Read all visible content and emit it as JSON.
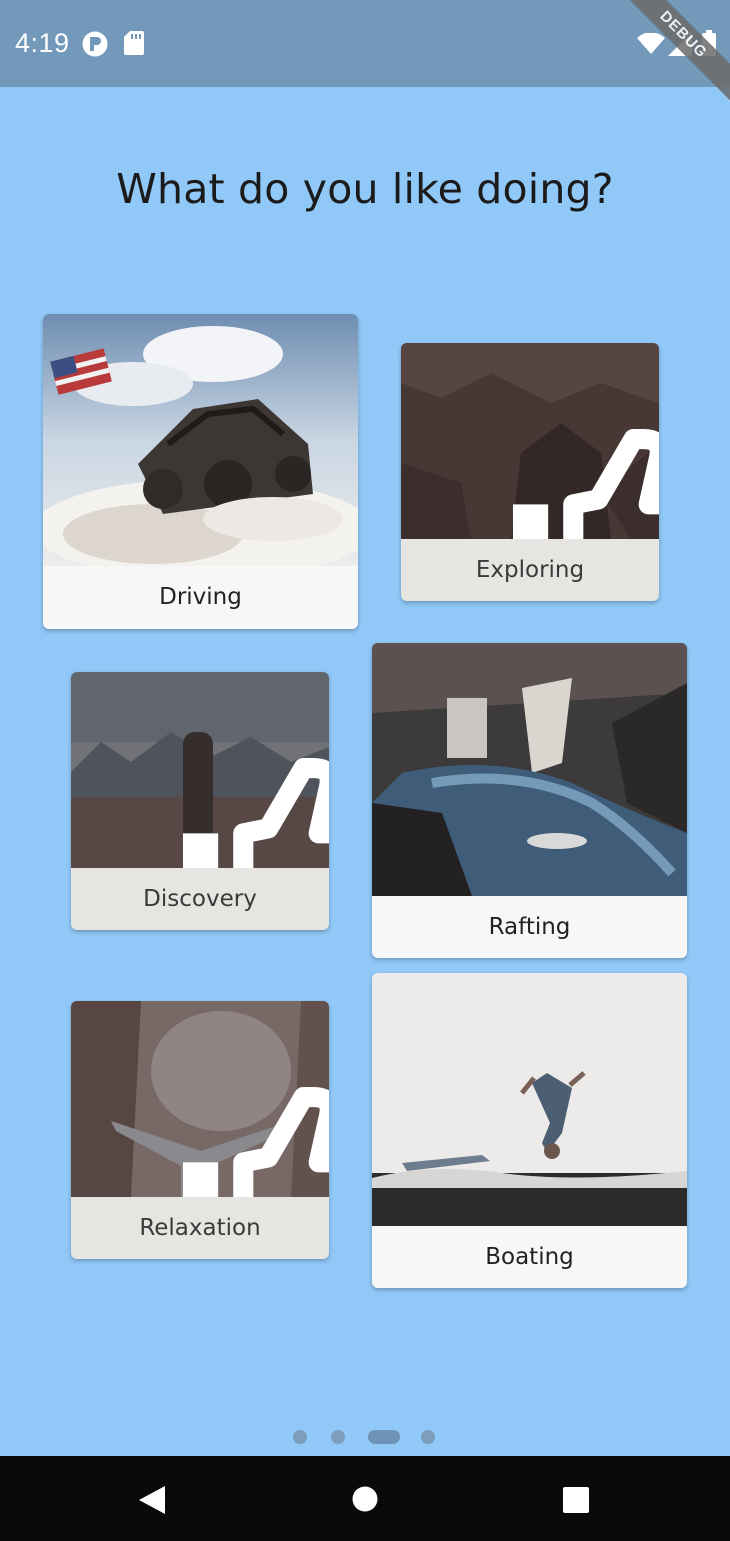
{
  "status_bar": {
    "time": "4:19",
    "icons": [
      "circle-p-icon",
      "sd-card-icon",
      "wifi-icon",
      "signal-icon",
      "battery-icon"
    ],
    "debug_label": "DEBUG"
  },
  "page": {
    "title": "What do you like doing?",
    "background": "#90c8f7"
  },
  "cards": [
    {
      "label": "Driving",
      "selected": false
    },
    {
      "label": "Exploring",
      "selected": true
    },
    {
      "label": "Discovery",
      "selected": true
    },
    {
      "label": "Rafting",
      "selected": false
    },
    {
      "label": "Relaxation",
      "selected": true
    },
    {
      "label": "Boating",
      "selected": false
    }
  ],
  "selected_icon": "thumbs-up-icon",
  "page_indicator": {
    "count": 4,
    "active_index": 2
  },
  "nav_bar": {
    "buttons": [
      "back-icon",
      "home-icon",
      "recents-icon"
    ]
  }
}
